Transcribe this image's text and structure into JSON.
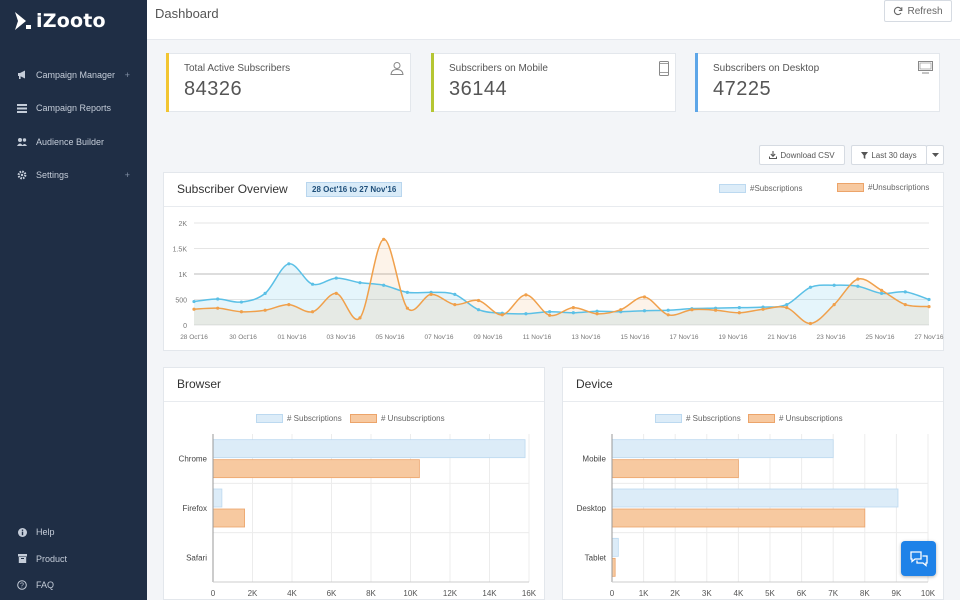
{
  "app": {
    "logo_text": "iZooto"
  },
  "sidebar": {
    "items": [
      {
        "label": "Campaign Manager",
        "icon": "megaphone-icon",
        "expandable": true
      },
      {
        "label": "Campaign Reports",
        "icon": "reports-icon",
        "expandable": false
      },
      {
        "label": "Audience Builder",
        "icon": "users-icon",
        "expandable": false
      },
      {
        "label": "Settings",
        "icon": "gear-icon",
        "expandable": true
      }
    ],
    "bottom": [
      {
        "label": "Help",
        "icon": "info-icon"
      },
      {
        "label": "Product",
        "icon": "product-icon"
      },
      {
        "label": "FAQ",
        "icon": "question-icon"
      }
    ],
    "plus_symbol": "+"
  },
  "header": {
    "title": "Dashboard",
    "refresh_label": "Refresh"
  },
  "stats": [
    {
      "label": "Total Active Subscribers",
      "value": "84326",
      "color": "#f2c531",
      "icon": "user-icon"
    },
    {
      "label": "Subscribers on Mobile",
      "value": "36144",
      "color": "#b5c633",
      "icon": "mobile-icon"
    },
    {
      "label": "Subscribers on Desktop",
      "value": "47225",
      "color": "#5da6e8",
      "icon": "desktop-icon"
    }
  ],
  "toolbar": {
    "download_label": "Download CSV",
    "range_label": "Last 30 days"
  },
  "overview": {
    "title": "Subscriber Overview",
    "date_range": "28 Oct'16 to 27 Nov'16",
    "legend": [
      "#Subscriptions",
      "#Unsubscriptions"
    ]
  },
  "browser": {
    "title": "Browser"
  },
  "device": {
    "title": "Device"
  },
  "bar_legend": [
    "# Subscriptions",
    "# Unsubscriptions"
  ],
  "colors": {
    "subscriptions": "#5bc0e6",
    "unsubscriptions": "#f0a04b",
    "sub_fill": "#dcecf8",
    "unsub_fill": "#f7c9a0"
  },
  "chart_data": [
    {
      "type": "line",
      "y_ticks": [
        "0",
        "500",
        "1K",
        "1.5K",
        "2K"
      ],
      "ylim": [
        0,
        2000
      ],
      "x_tick_labels": [
        "28 Oct'16",
        "30 Oct'16",
        "01 Nov'16",
        "03 Nov'16",
        "05 Nov'16",
        "07 Nov'16",
        "09 Nov'16",
        "11 Nov'16",
        "13 Nov'16",
        "15 Nov'16",
        "17 Nov'16",
        "19 Nov'16",
        "21 Nov'16",
        "23 Nov'16",
        "25 Nov'16",
        "27 Nov'16"
      ],
      "grid": true,
      "series": [
        {
          "name": "#Subscriptions",
          "values": [
            460,
            510,
            450,
            620,
            1200,
            800,
            920,
            830,
            780,
            640,
            640,
            600,
            300,
            230,
            220,
            260,
            240,
            270,
            260,
            280,
            290,
            320,
            330,
            340,
            350,
            400,
            740,
            780,
            760,
            620,
            650,
            500
          ]
        },
        {
          "name": "#Unsubscriptions",
          "values": [
            310,
            330,
            260,
            290,
            400,
            260,
            620,
            140,
            1680,
            330,
            600,
            400,
            480,
            200,
            590,
            190,
            340,
            220,
            300,
            550,
            200,
            300,
            290,
            240,
            310,
            340,
            30,
            400,
            900,
            680,
            400,
            360
          ]
        }
      ]
    },
    {
      "type": "bar",
      "title": "Browser",
      "categories": [
        "Chrome",
        "Firefox",
        "Safari"
      ],
      "x_ticks": [
        "0",
        "2K",
        "4K",
        "6K",
        "8K",
        "10K",
        "12K",
        "14K",
        "16K"
      ],
      "xlim": [
        0,
        16000
      ],
      "series": [
        {
          "name": "# Subscriptions",
          "values": [
            15800,
            450,
            0
          ]
        },
        {
          "name": "# Unsubscriptions",
          "values": [
            10450,
            1600,
            0
          ]
        }
      ]
    },
    {
      "type": "bar",
      "title": "Device",
      "categories": [
        "Mobile",
        "Desktop",
        "Tablet"
      ],
      "x_ticks": [
        "0",
        "1K",
        "2K",
        "3K",
        "4K",
        "5K",
        "6K",
        "7K",
        "8K",
        "9K",
        "10K"
      ],
      "xlim": [
        0,
        10000
      ],
      "series": [
        {
          "name": "# Subscriptions",
          "values": [
            7000,
            9050,
            200
          ]
        },
        {
          "name": "# Unsubscriptions",
          "values": [
            4000,
            8000,
            100
          ]
        }
      ]
    }
  ]
}
